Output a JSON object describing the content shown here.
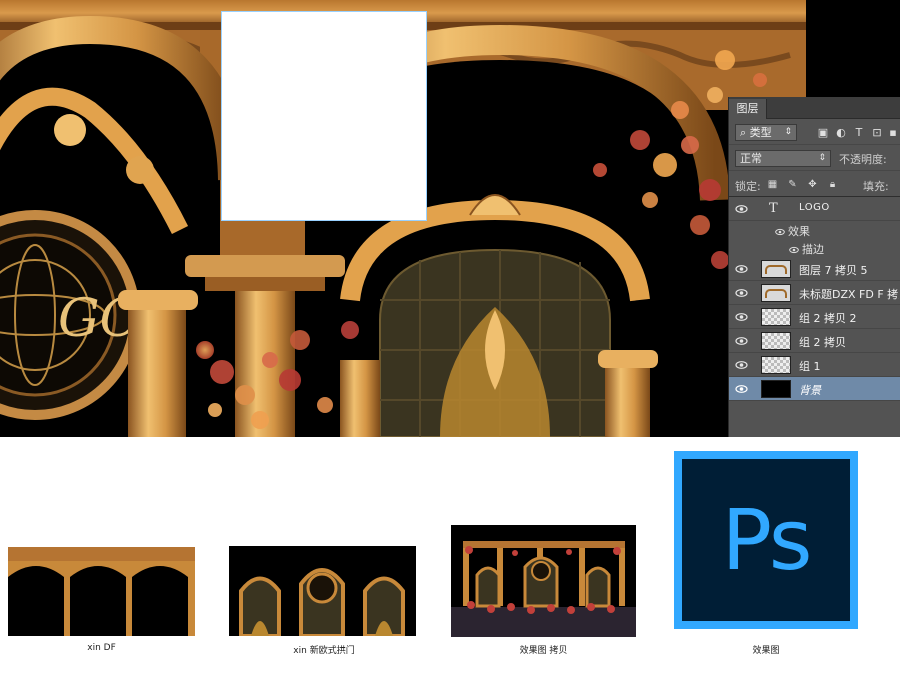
{
  "artwork": {
    "logo_text": "GO"
  },
  "ps_panel": {
    "tab_title": "图层",
    "filter_kind": "类型",
    "blend_mode": "正常",
    "opacity_label": "不透明度:",
    "lock_label": "锁定:",
    "fill_label": "填充:",
    "filter_icons": [
      "image-filter-icon",
      "adjustment-filter-icon",
      "type-filter-icon",
      "shape-filter-icon",
      "smart-object-filter-icon"
    ],
    "lock_icons": [
      "lock-transparent-icon",
      "lock-paint-icon",
      "lock-move-icon",
      "lock-all-icon"
    ],
    "layers": [
      {
        "type": "text",
        "name": "LOGO",
        "thumb": "T"
      },
      {
        "type": "effects",
        "name": "效果"
      },
      {
        "type": "effect",
        "name": "描边"
      },
      {
        "type": "image",
        "name": "图层 7 拷贝 5"
      },
      {
        "type": "image",
        "name": "未标题DZX FD F 拷贝"
      },
      {
        "type": "image",
        "name": "组 2 拷贝 2"
      },
      {
        "type": "image",
        "name": "组 2 拷贝"
      },
      {
        "type": "image",
        "name": "组 1"
      },
      {
        "type": "background",
        "name": "背景"
      }
    ]
  },
  "files": [
    {
      "label": "xin DF"
    },
    {
      "label": "xin 新欧式拱门",
      "selected": true
    },
    {
      "label": "效果图 拷贝"
    },
    {
      "label": "效果图",
      "icon_text": "Ps"
    }
  ],
  "colors": {
    "ps_panel_bg": "#535353",
    "ps_selected_row": "#6f8aa8",
    "ps_logo_blue": "#31a8ff",
    "ps_logo_dark": "#001e36",
    "gold": "#c8893a"
  }
}
